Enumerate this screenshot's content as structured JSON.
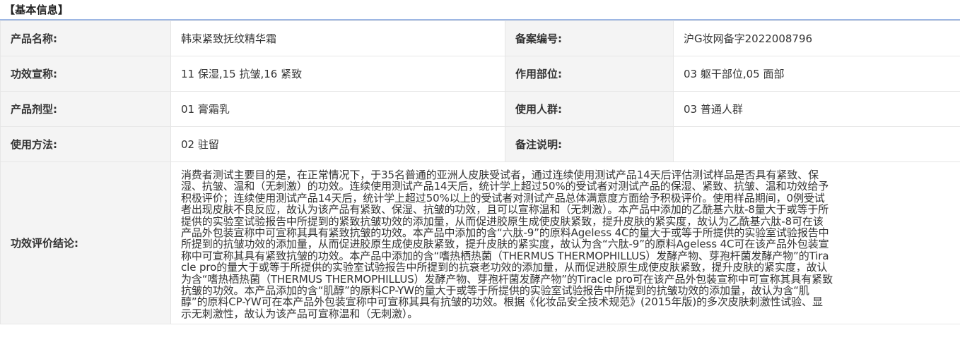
{
  "section": {
    "title": "【基本信息】"
  },
  "rows": [
    {
      "label1": "产品名称:",
      "value1": "韩束紧致抚纹精华霜",
      "label2": "备案编号:",
      "value2": "沪G妆网备字2022008796"
    },
    {
      "label1": "功效宣称:",
      "value1": "11 保湿,15 抗皱,16 紧致",
      "label2": "作用部位:",
      "value2": "03 躯干部位,05 面部"
    },
    {
      "label1": "产品剂型:",
      "value1": "01 膏霜乳",
      "label2": "使用人群:",
      "value2": "03 普通人群"
    },
    {
      "label1": "使用方法:",
      "value1": "02 驻留",
      "label2": "备注说明:",
      "value2": ""
    }
  ],
  "conclusion": {
    "label": "功效评价结论:",
    "text": "消费者测试主要目的是，在正常情况下，于35名普通的亚洲人皮肤受试者，通过连续使用测试产品14天后评估测试样品是否具有紧致、保湿、抗皱、温和（无刺激）的功效。连续使用测试产品14天后，统计学上超过50%的受试者对测试产品的保湿、紧致、抗皱、温和功效给予积极评价；连续使用测试产品14天后，统计学上超过50%以上的受试者对测试产品总体满意度方面给予积极评价。使用样品期间，0例受试者出现皮肤不良反应，故认为该产品有紧致、保湿、抗皱的功效，且可以宣称温和（无刺激）。本产品中添加的乙酰基六肽-8量大于或等于所提供的实验室试验报告中所提到的紧致抗皱功效的添加量，从而促进胶原生成使皮肤紧致，提升皮肤的紧实度，故认为乙酰基六肽-8可在该产品外包装宣称中可宣称其具有紧致抗皱的功效。本产品中添加的含“六肽-9”的原料Ageless 4C的量大于或等于所提供的实验室试验报告中所提到的抗皱功效的添加量，从而促进胶原生成使皮肤紧致，提升皮肤的紧实度，故认为含“六肽-9”的原料Ageless 4C可在该产品外包装宣称中可宣称其具有紧致抗皱的功效。本产品中添加的含“嗜热栖热菌（THERMUS THERMOPHILLUS）发酵产物、芽孢杆菌发酵产物”的Tiracle pro的量大于或等于所提供的实验室试验报告中所提到的抗衰老功效的添加量，从而促进胶原生成使皮肤紧致，提升皮肤的紧实度，故认为含“嗜热栖热菌（THERMUS THERMOPHILLUS）发酵产物、芽孢杆菌发酵产物”的Tiracle pro可在该产品外包装宣称中可宣称其具有紧致抗皱的功效。本产品添加的含“肌醇”的原料CP-YW的量大于或等于所提供的实验室试验报告中所提到的抗皱功效的添加量，故认为含“肌醇”的原料CP-YW可在本产品外包装宣称中可宣称其具有抗皱的功效。根据《化妆品安全技术规范》(2015年版)的多次皮肤刺激性试验、显示无刺激性，故认为该产品可宣称温和（无刺激）。"
  }
}
